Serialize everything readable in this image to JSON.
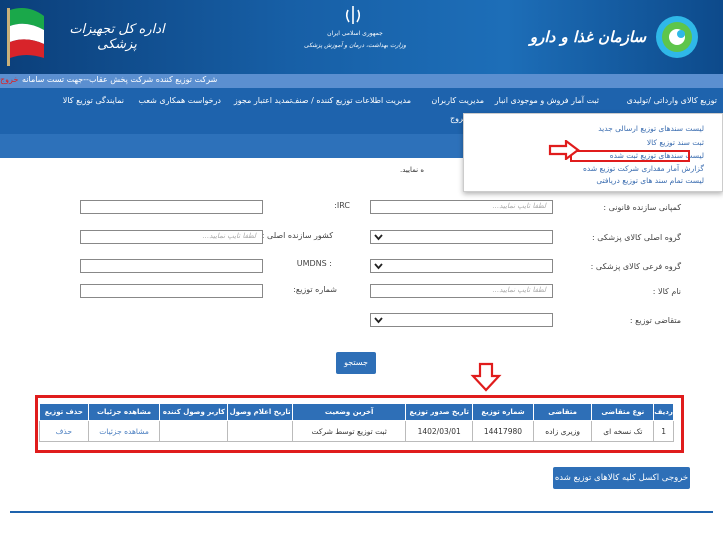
{
  "header": {
    "dept_name": "اداره کل تجهیزات پزشکی",
    "ministry_line1": "جمهوری اسلامی ایران",
    "ministry_line2": "وزارت بهداشت، درمان و آموزش پزشکی",
    "org_name": "سازمان غذا و دارو"
  },
  "company_bar": {
    "company_text": "شرکت توزیع کننده شرکت پخش عقاب--جهت تست سامانه",
    "logout_label": "خروج"
  },
  "nav": {
    "items": [
      "توزیع کالای وارداتی /تولیدی",
      "ثبت آمار فروش و موجودی انبار",
      "مدیریت کاربران",
      "مدیریت اطلاعات توزیع کننده / صنف",
      "تمدید اعتبار مجوز",
      "درخواست همکاری شعب",
      "نمایندگی توزیع کالا"
    ],
    "sub_item": "خروج"
  },
  "dropdown": {
    "items": [
      "لیست سندهای توزیع ارسالی جدید",
      "ثبت سند توزیع کالا",
      "لیست سندهای توزیع ثبت شده",
      "گزارش آمار مقداری شرکت توزیع شده",
      "لیست تمام سند های توزیع دریافتی"
    ]
  },
  "form": {
    "instruction": "ه نمایید.",
    "placeholder": "لطفا تایپ نمایید...",
    "labels": {
      "legal_company": "کمپانی سازنده قانونی :",
      "irc": "IRC:",
      "main_group": "گروه اصلی کالای پزشکی :",
      "origin_country": "کشور سازنده اصلی :",
      "sub_group": "گروه فرعی کالای پزشکی :",
      "umdns": ": UMDNS",
      "product_name": "نام کالا :",
      "dist_number": "شماره توزیع:",
      "dist_applicant": "متقاضی توزیع :"
    },
    "search_label": "جستجو"
  },
  "table": {
    "headers": [
      "ردیف",
      "نوع متقاضی",
      "متقاضی",
      "شماره توزیع",
      "تاریخ صدور توزیع",
      "آخرین وضعیت",
      "تاریخ اعلام وصول",
      "کاربر وصول کننده",
      "مشاهده جزئیات",
      "حذف توزیع"
    ],
    "rows": [
      [
        "1",
        "تک نسخه ای",
        "وزیری زاده",
        "14417980",
        "1402/03/01",
        "ثبت توزیع توسط شرکت",
        "",
        "",
        "مشاهده جزئیات",
        "حذف"
      ]
    ]
  },
  "excel_label": "خروجی اکسل کلیه کالاهای توزیع شده",
  "colors": {
    "nav_blue": "#1e63ad",
    "highlight_red": "#e01c1c",
    "button_blue": "#2e6fb7"
  }
}
